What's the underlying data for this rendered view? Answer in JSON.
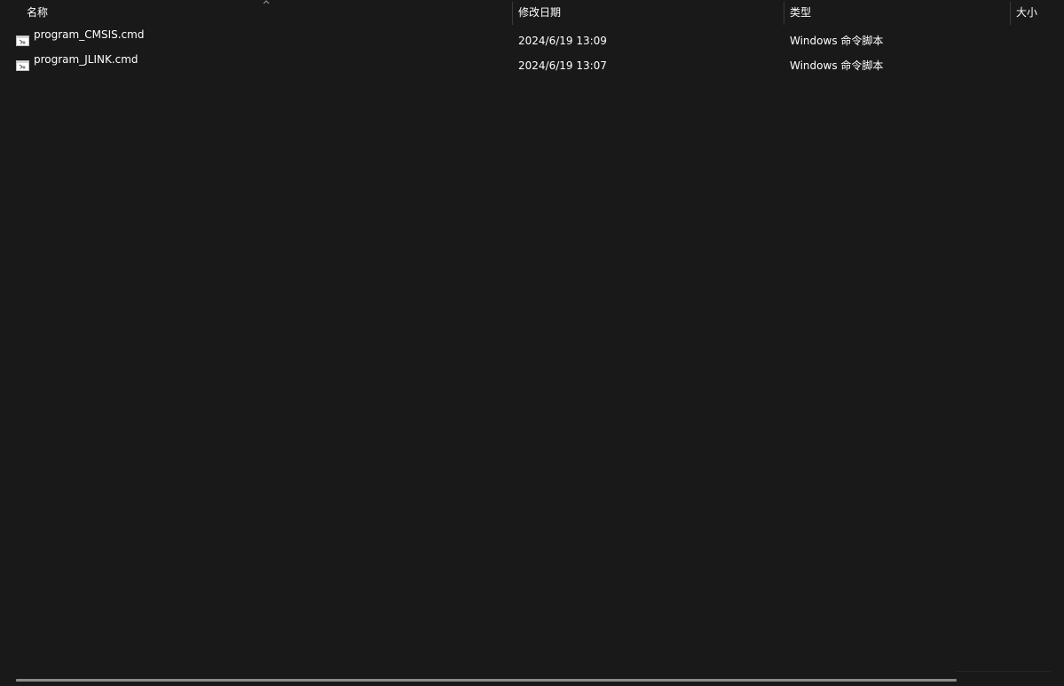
{
  "columns": {
    "name": "名称",
    "date_modified": "修改日期",
    "type": "类型",
    "size": "大小"
  },
  "sort": {
    "column": "name",
    "direction": "ascending",
    "icon": "chevron-up-icon"
  },
  "files": [
    {
      "name": "program_CMSIS.cmd",
      "date_modified": "2024/6/19 13:09",
      "type": "Windows 命令脚本",
      "size": "",
      "icon": "cmd-file-icon"
    },
    {
      "name": "program_JLINK.cmd",
      "date_modified": "2024/6/19 13:07",
      "type": "Windows 命令脚本",
      "size": "",
      "icon": "cmd-file-icon"
    }
  ],
  "colors": {
    "background": "#191919",
    "text": "#ffffff",
    "separator": "#3a3a3a",
    "scrollbar": "#8a8a8a"
  }
}
